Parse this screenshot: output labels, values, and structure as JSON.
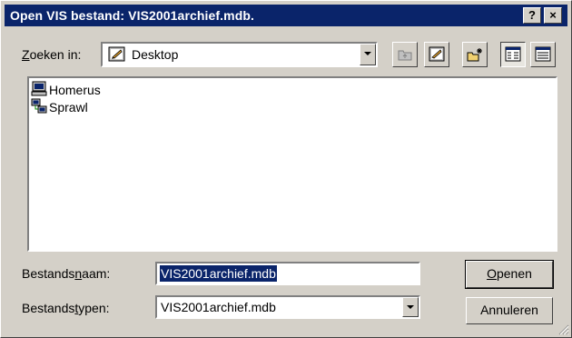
{
  "window": {
    "title": "Open VIS bestand: VIS2001archief.mdb.",
    "help_label": "?",
    "close_label": "×"
  },
  "lookin": {
    "label_prefix": "",
    "label_accel": "Z",
    "label_rest": "oeken in:",
    "value": "Desktop",
    "icon": "desktop-icon"
  },
  "toolbar": {
    "buttons": [
      {
        "name": "up-one-level-button",
        "icon": "folder-up-icon"
      },
      {
        "name": "desktop-button",
        "icon": "desktop-icon"
      },
      {
        "name": "new-folder-button",
        "icon": "new-folder-icon"
      },
      {
        "name": "list-view-button",
        "icon": "list-view-icon"
      },
      {
        "name": "details-view-button",
        "icon": "details-view-icon"
      }
    ]
  },
  "files": [
    {
      "label": "Homerus",
      "icon": "computer-icon"
    },
    {
      "label": "Sprawl",
      "icon": "network-neighborhood-icon"
    }
  ],
  "filename": {
    "label_prefix": "Bestands",
    "label_accel": "n",
    "label_rest": "aam:",
    "value": "VIS2001archief.mdb"
  },
  "filetype": {
    "label_prefix": "Bestands",
    "label_accel": "t",
    "label_rest": "ypen:",
    "value": "VIS2001archief.mdb"
  },
  "buttons": {
    "open_accel": "O",
    "open_rest": "penen",
    "cancel": "Annuleren"
  },
  "colors": {
    "titlebar": "#0a246a",
    "face": "#d4d0c8",
    "selection": "#0a246a"
  }
}
